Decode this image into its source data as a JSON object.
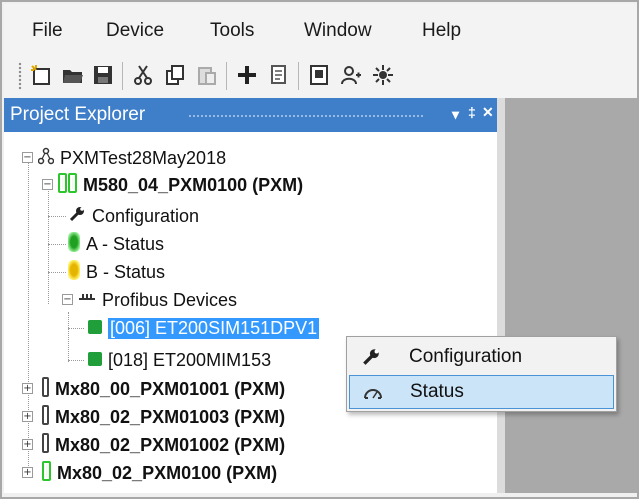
{
  "menu": [
    "File",
    "Device",
    "Tools",
    "Window",
    "Help"
  ],
  "toolbar": {
    "icons": [
      "new-project-icon",
      "open-icon",
      "save-icon",
      "cut-icon",
      "copy-icon",
      "paste-icon",
      "add-icon",
      "properties-icon",
      "module-icon",
      "user-icon",
      "network-icon"
    ]
  },
  "panel": {
    "title": "Project Explorer",
    "dropdown_glyph": "▾",
    "pin_glyph": "‡",
    "close_glyph": "✕"
  },
  "tree": {
    "root": "PXMTest28May2018",
    "gateway": "M580_04_PXM0100 (PXM)",
    "configuration": "Configuration",
    "status_a": "A - Status",
    "status_b": "B - Status",
    "profibus": "Profibus Devices",
    "device1": "[006] ET200SIM151DPV1",
    "device2": "[018] ET200MIM153",
    "gw2": "Mx80_00_PXM01001 (PXM)",
    "gw3": "Mx80_02_PXM01003 (PXM)",
    "gw4": "Mx80_02_PXM01002 (PXM)",
    "gw5": "Mx80_02_PXM0100 (PXM)"
  },
  "context_menu": {
    "items": [
      "Configuration",
      "Status"
    ]
  },
  "colors": {
    "accent": "#3f7fc9",
    "selection": "#3399ff",
    "status_green": "#20a020",
    "status_yellow": "#e5b400"
  }
}
